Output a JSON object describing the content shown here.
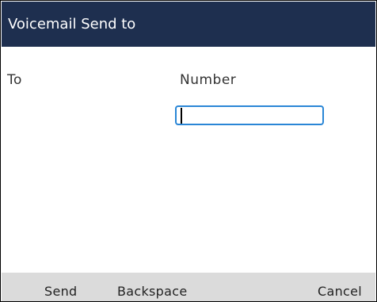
{
  "header": {
    "title": "Voicemail Send to"
  },
  "form": {
    "to_label": "To",
    "number_label": "Number",
    "number_value": ""
  },
  "softkeys": {
    "send": "Send",
    "backspace": "Backspace",
    "cancel": "Cancel"
  },
  "colors": {
    "title_bar": "#1e2f4f",
    "input_border": "#2a86d6",
    "softkey_bar": "#dbdbdb"
  }
}
